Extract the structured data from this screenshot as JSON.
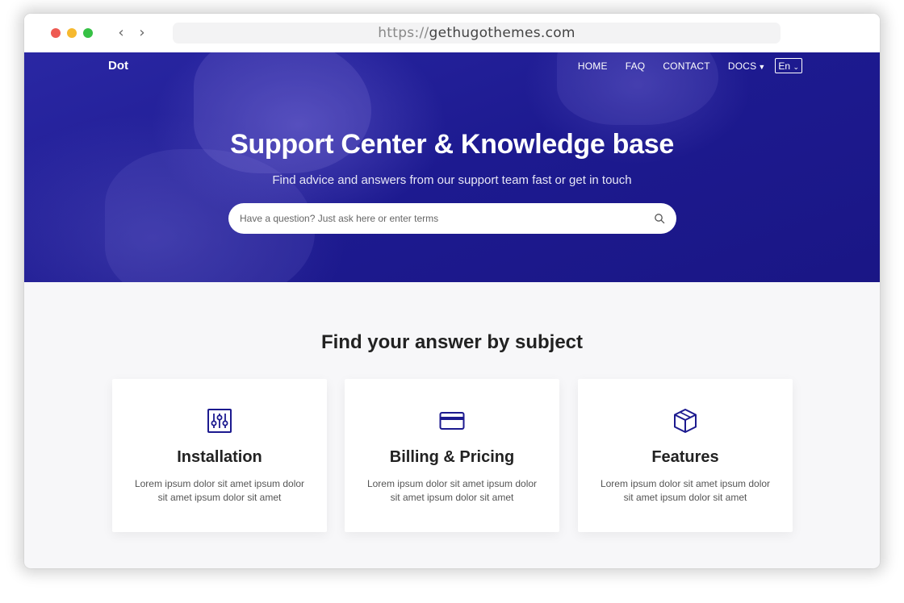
{
  "browser": {
    "url_protocol": "https://",
    "url_host": "gethugothemes.com"
  },
  "nav": {
    "brand": "Dot",
    "links": [
      "HOME",
      "FAQ",
      "CONTACT",
      "DOCS"
    ],
    "language": "En"
  },
  "hero": {
    "title": "Support Center & Knowledge base",
    "subtitle": "Find advice and answers from our support team fast or get in touch",
    "search_placeholder": "Have a question? Just ask here or enter terms"
  },
  "subjects": {
    "heading": "Find your answer by subject",
    "cards": [
      {
        "title": "Installation",
        "text": "Lorem ipsum dolor sit amet ipsum dolor sit amet ipsum dolor sit amet",
        "icon": "sliders-icon"
      },
      {
        "title": "Billing & Pricing",
        "text": "Lorem ipsum dolor sit amet ipsum dolor sit amet ipsum dolor sit amet",
        "icon": "credit-card-icon"
      },
      {
        "title": "Features",
        "text": "Lorem ipsum dolor sit amet ipsum dolor sit amet ipsum dolor sit amet",
        "icon": "box-icon"
      }
    ]
  },
  "colors": {
    "hero_background": "#1c1a8f",
    "icon_accent": "#1c1a8f"
  }
}
